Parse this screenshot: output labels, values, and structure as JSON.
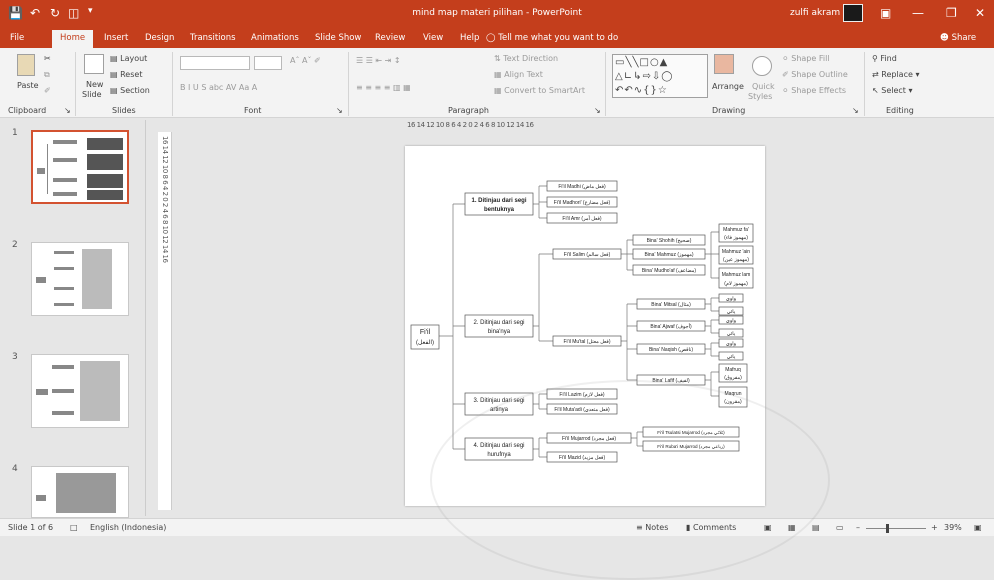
{
  "titlebar": {
    "title": "mind map materi pilihan - PowerPoint",
    "user": "zulfi akram"
  },
  "tabs": [
    "File",
    "Home",
    "Insert",
    "Design",
    "Transitions",
    "Animations",
    "Slide Show",
    "Review",
    "View",
    "Help"
  ],
  "tell_me": "Tell me what you want to do",
  "share": "Share",
  "ribbon": {
    "clipboard": {
      "label": "Clipboard",
      "paste": "Paste"
    },
    "slides": {
      "label": "Slides",
      "new_slide": "New",
      "new_slide2": "Slide",
      "layout": "Layout",
      "reset": "Reset",
      "section": "Section"
    },
    "font": {
      "label": "Font",
      "buttons": "B I U S abc AV Aa A"
    },
    "paragraph": {
      "label": "Paragraph",
      "text_direction": "Text Direction",
      "align_text": "Align Text",
      "convert": "Convert to SmartArt"
    },
    "drawing": {
      "label": "Drawing",
      "arrange": "Arrange",
      "quick": "Quick",
      "styles": "Styles",
      "shape_fill": "Shape Fill",
      "shape_outline": "Shape Outline",
      "shape_effects": "Shape Effects"
    },
    "editing": {
      "label": "Editing",
      "find": "Find",
      "replace": "Replace",
      "select": "Select"
    }
  },
  "ruler_h": "16 14 12 10 8 6 4 2 0 2 4 6 8 10 12 14 16",
  "ruler_v": "16 14 12 10 8 6 4 2 0 2 4 6 8 10 12 14 16",
  "thumbnails": [
    "1",
    "2",
    "3",
    "4"
  ],
  "mindmap": {
    "root": "Fi'il",
    "root_ar": "(الفعل)",
    "b1": "1. Ditinjau dari segi",
    "b1b": "bentuknya",
    "b1_items": [
      "Fi'il Madhi (فعل ماض)",
      "Fi'il Madhori' (فعل مضارع)",
      "Fi'il Amr (فعل أمر)"
    ],
    "b2": "2. Ditinjau dari segi",
    "b2b": "bina'nya",
    "salim": "Fi'il Salim (فعل سالم)",
    "salim_items": [
      "Bina' Shohih (صحيح)",
      "Bina' Mahmuz (مهموز)",
      "Bina' Mudho'af (مضاعف)"
    ],
    "mahmuz": [
      "Mahmuz fa'",
      "(مهموز فاء)",
      "Mahmuz 'ain",
      "(مهموز عين)",
      "Mahmuz lam",
      "(مهموز لام)"
    ],
    "mutal": "Fi'il Mu'tal (فعل معتل)",
    "mutal_items": [
      "Bina' Mitsal (مثال)",
      "Bina' Ajwaf (أجوف)",
      "Bina' Naqish (ناقص)",
      "Bina' Lafif (لفيف)"
    ],
    "wawi": "واوي",
    "yai": "يائي",
    "mafruq": [
      "Mafruq",
      "(مفروق)"
    ],
    "maqrun": [
      "Maqrun",
      "(مقرون)"
    ],
    "b3": "3. Ditinjau dari segi",
    "b3b": "artinya",
    "b3_items": [
      "Fi'il Lazim (فعل لازم)",
      "Fi'il Muta'adi (فعل متعدي)"
    ],
    "b4": "4. Ditinjau dari segi",
    "b4b": "hurufnya",
    "b4_items": [
      "Fi'il Mujarrod (فعل مجرد)",
      "Fi'il Mazid (فعل مزيد)"
    ],
    "mujarrod_items": [
      "Fi'il Tsulatsi Mujarrod (ثلاثي مجرد)",
      "Fi'il Ruba'i Mujarrod (رباعي مجرد)"
    ]
  },
  "status": {
    "slide": "Slide 1 of 6",
    "language": "English (Indonesia)",
    "notes": "Notes",
    "comments": "Comments",
    "zoom": "39%"
  },
  "colors": {
    "accent": "#c43e1c"
  }
}
